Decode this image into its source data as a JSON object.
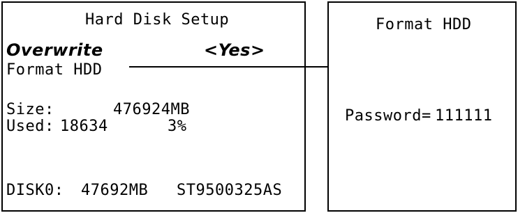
{
  "left_panel": {
    "title": "Hard Disk Setup",
    "overwrite_label": "Overwrite",
    "overwrite_value": "<Yes>",
    "format_label": "Format HDD",
    "size_label": "Size:",
    "size_value": "476924MB",
    "used_label": "Used:",
    "used_value": "18634",
    "used_percent": "3%",
    "disk_label": "DISK0:",
    "disk_size": "47692MB",
    "disk_model": "ST9500325AS"
  },
  "right_panel": {
    "title": "Format HDD",
    "password_label": "Password=",
    "password_value": "111111"
  }
}
